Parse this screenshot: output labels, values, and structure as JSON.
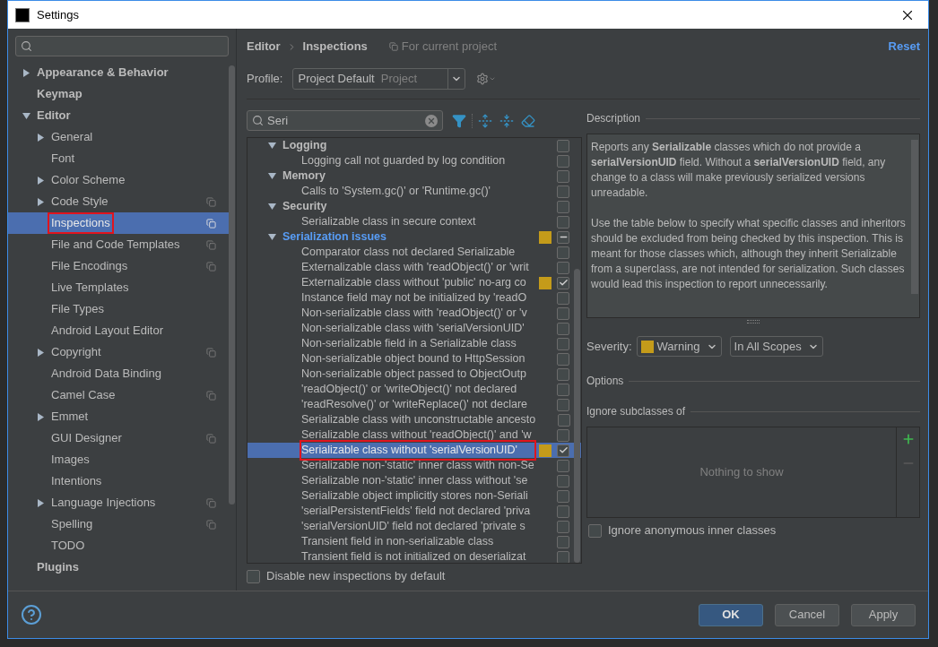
{
  "window": {
    "title": "Settings"
  },
  "sidebar": {
    "items": [
      {
        "label": "Appearance & Behavior",
        "expanded": false,
        "selected": false,
        "outlined": false
      },
      {
        "label": "Keymap",
        "selected": false,
        "outlined": false
      },
      {
        "label": "Editor",
        "expanded": true,
        "selected": false,
        "outlined": false,
        "children": [
          {
            "label": "General",
            "expanded": false,
            "selected": false,
            "project_scope": false,
            "outlined": false
          },
          {
            "label": "Font",
            "selected": false,
            "project_scope": false,
            "outlined": false
          },
          {
            "label": "Color Scheme",
            "expanded": false,
            "selected": false,
            "project_scope": false,
            "outlined": false
          },
          {
            "label": "Code Style",
            "expanded": false,
            "selected": false,
            "project_scope": true,
            "outlined": false
          },
          {
            "label": "Inspections",
            "selected": true,
            "project_scope": true,
            "outlined": true
          },
          {
            "label": "File and Code Templates",
            "selected": false,
            "project_scope": true,
            "outlined": false
          },
          {
            "label": "File Encodings",
            "selected": false,
            "project_scope": true,
            "outlined": false
          },
          {
            "label": "Live Templates",
            "selected": false,
            "project_scope": false,
            "outlined": false
          },
          {
            "label": "File Types",
            "selected": false,
            "project_scope": false,
            "outlined": false
          },
          {
            "label": "Android Layout Editor",
            "selected": false,
            "project_scope": false,
            "outlined": false
          },
          {
            "label": "Copyright",
            "expanded": false,
            "selected": false,
            "project_scope": true,
            "outlined": false
          },
          {
            "label": "Android Data Binding",
            "selected": false,
            "project_scope": false,
            "outlined": false
          },
          {
            "label": "Camel Case",
            "selected": false,
            "project_scope": true,
            "outlined": false
          },
          {
            "label": "Emmet",
            "expanded": false,
            "selected": false,
            "project_scope": false,
            "outlined": false
          },
          {
            "label": "GUI Designer",
            "selected": false,
            "project_scope": true,
            "outlined": false
          },
          {
            "label": "Images",
            "selected": false,
            "project_scope": false,
            "outlined": false
          },
          {
            "label": "Intentions",
            "selected": false,
            "project_scope": false,
            "outlined": false
          },
          {
            "label": "Language Injections",
            "expanded": false,
            "selected": false,
            "project_scope": true,
            "outlined": false
          },
          {
            "label": "Spelling",
            "selected": false,
            "project_scope": true,
            "outlined": false
          },
          {
            "label": "TODO",
            "selected": false,
            "project_scope": false,
            "outlined": false
          }
        ]
      },
      {
        "label": "Plugins",
        "selected": false,
        "outlined": false
      }
    ]
  },
  "breadcrumb": [
    "Editor",
    "Inspections"
  ],
  "scope_note": "For current project",
  "reset": "Reset",
  "profile": {
    "label": "Profile:",
    "value": "Project Default",
    "scope": "Project"
  },
  "filter": {
    "value": "Seri"
  },
  "inspections": [
    {
      "name": "Logging",
      "expanded": true,
      "highlighted": false,
      "partial": false,
      "children": [
        {
          "name": "Logging call not guarded by log condition",
          "checked": false,
          "selected": false,
          "outlined": false
        }
      ]
    },
    {
      "name": "Memory",
      "expanded": true,
      "highlighted": false,
      "partial": false,
      "children": [
        {
          "name": "Calls to 'System.gc()' or 'Runtime.gc()'",
          "checked": false,
          "selected": false,
          "outlined": false
        }
      ]
    },
    {
      "name": "Security",
      "expanded": true,
      "highlighted": false,
      "partial": false,
      "children": [
        {
          "name": "Serializable class in secure context",
          "checked": false,
          "selected": false,
          "outlined": false
        }
      ]
    },
    {
      "name": "Serialization issues",
      "expanded": true,
      "highlighted": true,
      "partial": true,
      "color": "#c49b1a",
      "children": [
        {
          "name": "Comparator class not declared Serializable",
          "checked": false,
          "selected": false,
          "outlined": false
        },
        {
          "name": "Externalizable class with 'readObject()' or 'writ",
          "checked": false,
          "selected": false,
          "outlined": false
        },
        {
          "name": "Externalizable class without 'public' no-arg co",
          "checked": true,
          "color": "#c49b1a",
          "selected": false,
          "outlined": false
        },
        {
          "name": "Instance field may not be initialized by 'readO",
          "checked": false,
          "selected": false,
          "outlined": false
        },
        {
          "name": "Non-serializable class with 'readObject()' or 'v",
          "checked": false,
          "selected": false,
          "outlined": false
        },
        {
          "name": "Non-serializable class with 'serialVersionUID'",
          "checked": false,
          "selected": false,
          "outlined": false
        },
        {
          "name": "Non-serializable field in a Serializable class",
          "checked": false,
          "selected": false,
          "outlined": false
        },
        {
          "name": "Non-serializable object bound to HttpSession",
          "checked": false,
          "selected": false,
          "outlined": false
        },
        {
          "name": "Non-serializable object passed to ObjectOutp",
          "checked": false,
          "selected": false,
          "outlined": false
        },
        {
          "name": "'readObject()' or 'writeObject()' not declared",
          "checked": false,
          "selected": false,
          "outlined": false
        },
        {
          "name": "'readResolve()' or 'writeReplace()' not declare",
          "checked": false,
          "selected": false,
          "outlined": false
        },
        {
          "name": "Serializable class with unconstructable ancesto",
          "checked": false,
          "selected": false,
          "outlined": false
        },
        {
          "name": "Serializable class without 'readObject()' and 'w",
          "checked": false,
          "selected": false,
          "outlined": false
        },
        {
          "name": "Serializable class without 'serialVersionUID'",
          "checked": true,
          "color": "#c49b1a",
          "selected": true,
          "outlined": true
        },
        {
          "name": "Serializable non-'static' inner class with non-Se",
          "checked": false,
          "selected": false,
          "outlined": false
        },
        {
          "name": "Serializable non-'static' inner class without 'se",
          "checked": false,
          "selected": false,
          "outlined": false
        },
        {
          "name": "Serializable object implicitly stores non-Seriali",
          "checked": false,
          "selected": false,
          "outlined": false
        },
        {
          "name": "'serialPersistentFields' field not declared 'priva",
          "checked": false,
          "selected": false,
          "outlined": false
        },
        {
          "name": "'serialVersionUID' field not declared 'private s",
          "checked": false,
          "selected": false,
          "outlined": false
        },
        {
          "name": "Transient field in non-serializable class",
          "checked": false,
          "selected": false,
          "outlined": false
        },
        {
          "name": "Transient field is not initialized on deserializat",
          "checked": false,
          "selected": false,
          "outlined": false
        }
      ]
    }
  ],
  "disable_new": {
    "label": "Disable new inspections by default",
    "checked": false
  },
  "description": {
    "title": "Description",
    "paragraphs": [
      "Reports any **Serializable** classes which do not provide a **serialVersionUID** field. Without a **serialVersionUID** field, any change to a class will make previously serialized versions unreadable.",
      "Use the table below to specify what specific classes and inheritors should be excluded from being checked by this inspection. This is meant for those classes which, although they inherit Serializable from a superclass, are not intended for serialization. Such classes would lead this inspection to report unnecessarily."
    ]
  },
  "severity": {
    "label": "Severity:",
    "value": "Warning",
    "color": "#c49b1a",
    "scope": "In All Scopes"
  },
  "options": {
    "title": "Options",
    "ignore_subclasses": {
      "title": "Ignore subclasses of",
      "empty_text": "Nothing to show"
    },
    "ignore_anonymous": {
      "label": "Ignore anonymous inner classes",
      "checked": false
    }
  },
  "buttons": [
    {
      "label": "OK",
      "default": true
    },
    {
      "label": "Cancel",
      "default": false
    },
    {
      "label": "Apply",
      "default": false
    }
  ]
}
